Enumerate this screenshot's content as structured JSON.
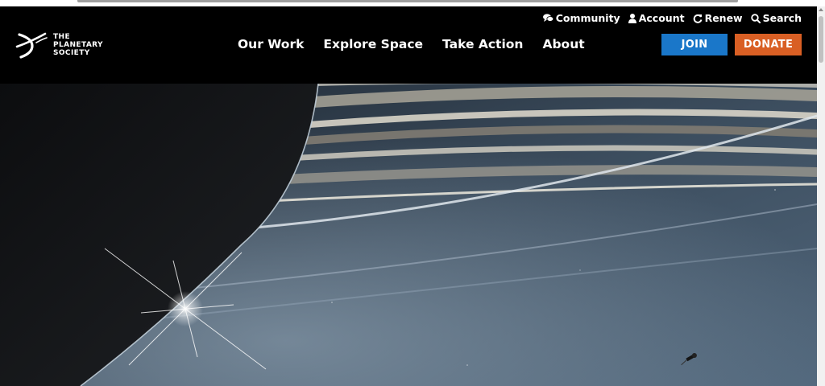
{
  "logo": {
    "text": "THE\nPLANETARY\nSOCIETY",
    "icon": "planetary-society-logo-icon"
  },
  "utility_nav": [
    {
      "label": "Community",
      "icon": "comments-icon"
    },
    {
      "label": "Account",
      "icon": "user-icon"
    },
    {
      "label": "Renew",
      "icon": "refresh-icon"
    },
    {
      "label": "Search",
      "icon": "search-icon"
    }
  ],
  "main_nav": [
    {
      "label": "Our Work"
    },
    {
      "label": "Explore Space"
    },
    {
      "label": "Take Action"
    },
    {
      "label": "About"
    }
  ],
  "buttons": {
    "join": "JOIN",
    "donate": "DONATE"
  },
  "colors": {
    "header_bg": "#000000",
    "join_bg": "#1a77c9",
    "donate_bg": "#d95f24",
    "text": "#ffffff"
  },
  "hero": {
    "subject": "saturn-rings-cassini-image"
  }
}
